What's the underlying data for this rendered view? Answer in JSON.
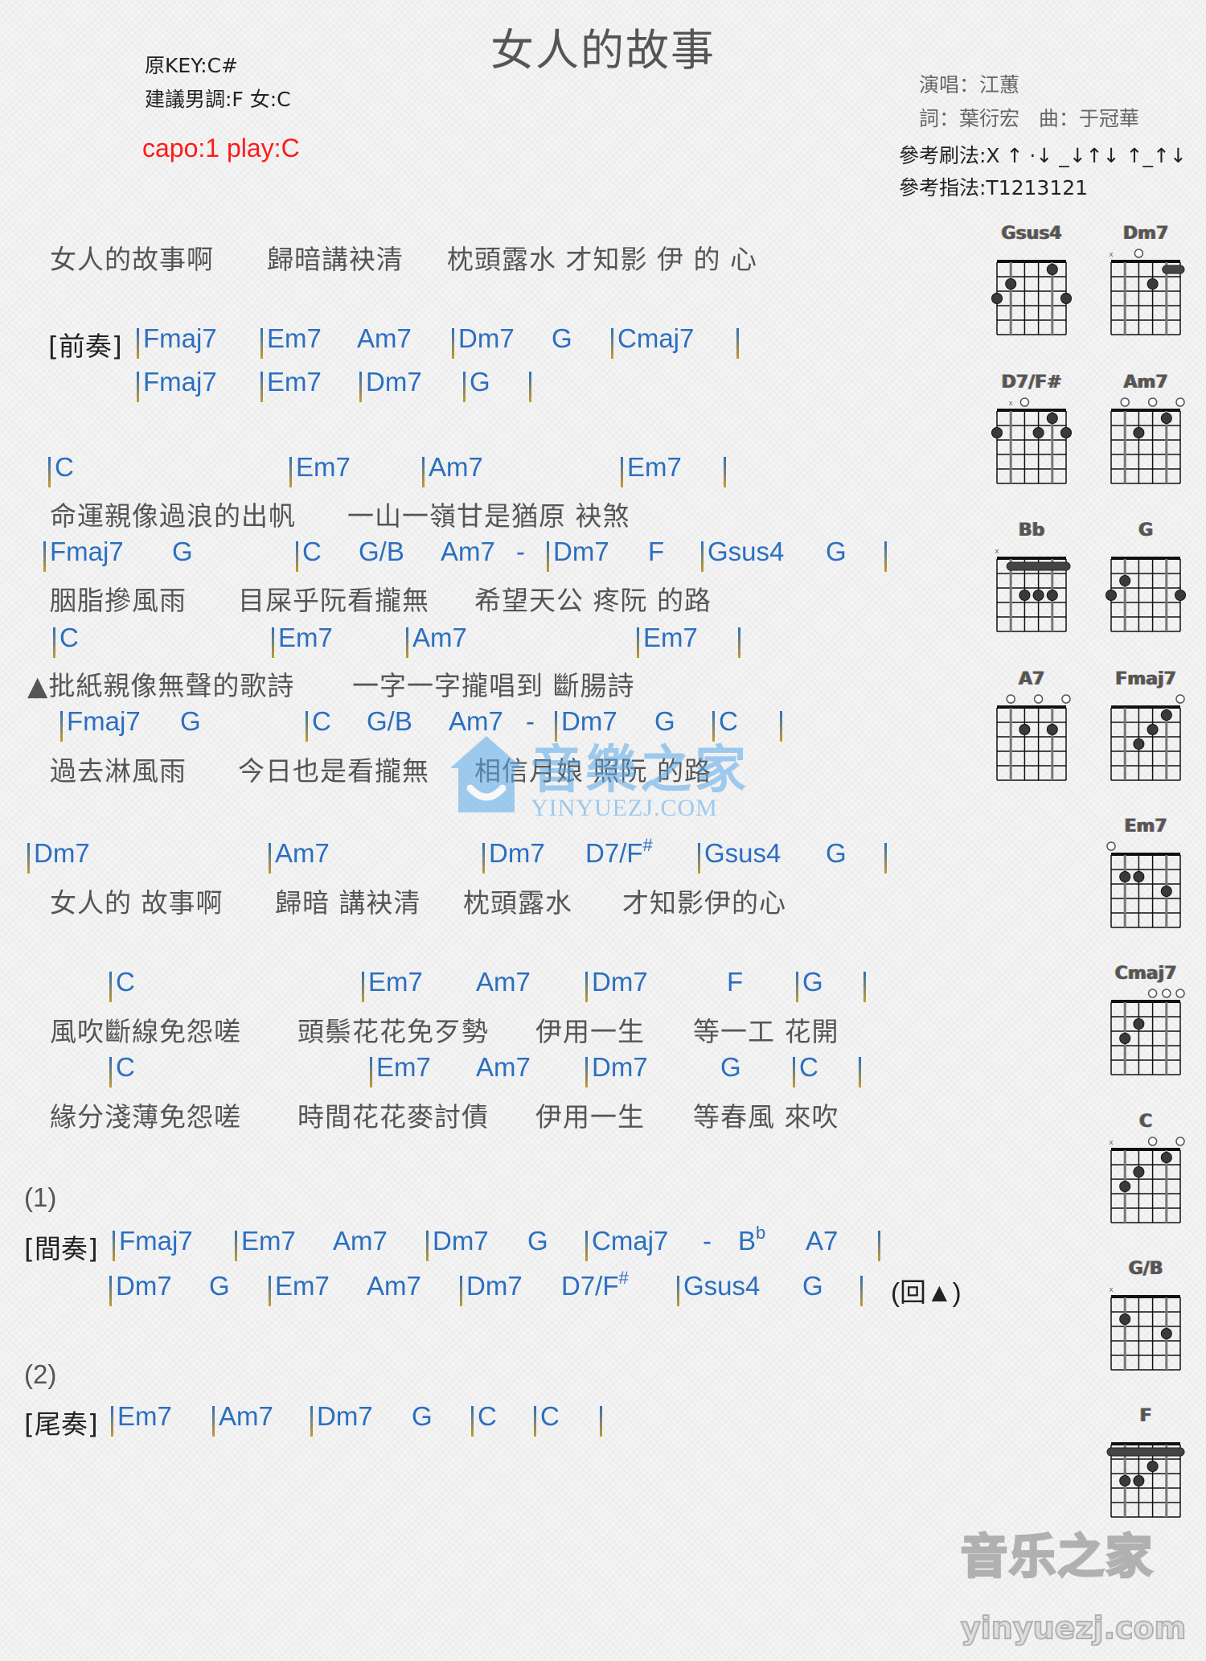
{
  "header": {
    "title": "女人的故事",
    "original_key": "原KEY:C#",
    "suggested_key": "建議男調:F 女:C",
    "capo": "capo:1 play:C",
    "singer": "演唱：江蕙",
    "writers": "詞：葉衍宏   曲：于冠華",
    "strum": "參考刷法:X ↑ ·↓ _↓↑↓ ↑_↑↓",
    "fingering": "參考指法:T1213121"
  },
  "intro_lyric": [
    "女人的故事啊",
    "歸暗講袂清",
    "枕頭露水 才知影 伊 的 心"
  ],
  "prelude": {
    "label": "[前奏]",
    "line1": [
      "Fmaj7",
      "Em7",
      "Am7",
      "Dm7",
      "G",
      "Cmaj7"
    ],
    "line2": [
      "Fmaj7",
      "Em7",
      "Dm7",
      "G"
    ]
  },
  "verse": {
    "l1_chords": [
      "C",
      "Em7",
      "Am7",
      "Em7"
    ],
    "l1_lyric": [
      "命運親像過浪的出帆",
      "一山一嶺甘是猶原 袂煞"
    ],
    "l2_chords": [
      "Fmaj7",
      "G",
      "C",
      "G/B",
      "Am7",
      "-",
      "Dm7",
      "F",
      "Gsus4",
      "G"
    ],
    "l2_lyric": [
      "胭脂摻風雨",
      "目屎乎阮看攏無",
      "希望天公 疼阮 的路"
    ],
    "l3_chords": [
      "C",
      "Em7",
      "Am7",
      "Em7"
    ],
    "l3_lyric": [
      "▲批紙親像無聲的歌詩",
      "一字一字攏唱到 斷腸詩"
    ],
    "l4_chords": [
      "Fmaj7",
      "G",
      "C",
      "G/B",
      "Am7",
      "-",
      "Dm7",
      "G",
      "C"
    ],
    "l4_lyric": [
      "過去淋風雨",
      "今日也是看攏無",
      "相信月娘 照阮 的路"
    ]
  },
  "chorus": {
    "l1_chords": [
      "Dm7",
      "Am7",
      "Dm7",
      "D7/F",
      "#",
      "Gsus4",
      "G"
    ],
    "l1_lyric": [
      "女人的 故事啊",
      "歸暗 講袂清",
      "枕頭露水",
      "才知影伊的心"
    ]
  },
  "bridge": {
    "l1_chords": [
      "C",
      "Em7",
      "Am7",
      "Dm7",
      "F",
      "G"
    ],
    "l1_lyric": [
      "風吹斷線免怨嗟",
      "頭鬃花花免歹勢",
      "伊用一生",
      "等一工 花開"
    ],
    "l2_chords": [
      "C",
      "Em7",
      "Am7",
      "Dm7",
      "G",
      "C"
    ],
    "l2_lyric": [
      "緣分淺薄免怨嗟",
      "時間花花麥討債",
      "伊用一生",
      "等春風 來吹"
    ]
  },
  "interlude": {
    "marker": "(1)",
    "label": "[間奏]",
    "line1": [
      "Fmaj7",
      "Em7",
      "Am7",
      "Dm7",
      "G",
      "Cmaj7",
      "-",
      "B",
      "b",
      "A7"
    ],
    "line2": [
      "Dm7",
      "G",
      "Em7",
      "Am7",
      "Dm7",
      "D7/F",
      "#",
      "Gsus4",
      "G"
    ],
    "repeat": "(回▲)"
  },
  "outro": {
    "marker": "(2)",
    "label": "[尾奏]",
    "line1": [
      "Em7",
      "Am7",
      "Dm7",
      "G",
      "C",
      "C"
    ]
  },
  "chord_diagrams": [
    {
      "name": "Gsus4",
      "top": [
        "",
        "",
        "",
        "",
        "",
        ""
      ],
      "dots": [
        [
          6,
          3
        ],
        [
          5,
          2
        ],
        [
          2,
          1
        ],
        [
          1,
          3
        ]
      ],
      "barre": null
    },
    {
      "name": "Dm7",
      "top": [
        "x",
        "",
        "o",
        "",
        "",
        ""
      ],
      "dots": [
        [
          3,
          2
        ]
      ],
      "barre": [
        1,
        2,
        1
      ]
    },
    {
      "name": "D7/F#",
      "top": [
        "",
        "x",
        "o",
        "",
        "",
        ""
      ],
      "dots": [
        [
          6,
          2
        ],
        [
          3,
          2
        ],
        [
          2,
          1
        ],
        [
          1,
          2
        ]
      ],
      "barre": null
    },
    {
      "name": "Am7",
      "top": [
        "",
        "o",
        "",
        "o",
        "",
        "o"
      ],
      "dots": [
        [
          4,
          2
        ],
        [
          2,
          1
        ]
      ],
      "barre": null
    },
    {
      "name": "Bb",
      "top": [
        "x",
        "",
        "",
        "",
        "",
        ""
      ],
      "dots": [
        [
          4,
          3
        ],
        [
          3,
          3
        ],
        [
          2,
          3
        ]
      ],
      "barre": [
        1,
        5,
        1
      ]
    },
    {
      "name": "G",
      "top": [
        "",
        "",
        "",
        "",
        "",
        ""
      ],
      "dots": [
        [
          6,
          3
        ],
        [
          5,
          2
        ],
        [
          1,
          3
        ]
      ],
      "barre": null
    },
    {
      "name": "A7",
      "top": [
        "",
        "o",
        "",
        "o",
        "",
        "o"
      ],
      "dots": [
        [
          4,
          2
        ],
        [
          2,
          2
        ]
      ],
      "barre": null
    },
    {
      "name": "Fmaj7",
      "top": [
        "",
        "",
        "",
        "",
        "",
        "o"
      ],
      "dots": [
        [
          4,
          3
        ],
        [
          3,
          2
        ],
        [
          2,
          1
        ]
      ],
      "barre": null
    },
    {
      "name": "Em7",
      "top": [
        "o",
        "",
        "",
        "",
        "",
        ""
      ],
      "dots": [
        [
          5,
          2
        ],
        [
          4,
          2
        ],
        [
          2,
          3
        ]
      ],
      "barre": null
    },
    {
      "name": "Cmaj7",
      "top": [
        "",
        "",
        "",
        "o",
        "o",
        "o"
      ],
      "dots": [
        [
          5,
          3
        ],
        [
          4,
          2
        ]
      ],
      "barre": null
    },
    {
      "name": "C",
      "top": [
        "x",
        "",
        "",
        "o",
        "",
        "o"
      ],
      "dots": [
        [
          5,
          3
        ],
        [
          4,
          2
        ],
        [
          2,
          1
        ]
      ],
      "barre": null
    },
    {
      "name": "G/B",
      "top": [
        "x",
        "",
        "",
        "",
        "",
        ""
      ],
      "dots": [
        [
          5,
          2
        ],
        [
          2,
          3
        ]
      ],
      "barre": null
    },
    {
      "name": "F",
      "top": [
        "",
        "",
        "",
        "",
        "",
        ""
      ],
      "dots": [
        [
          5,
          3
        ],
        [
          4,
          3
        ],
        [
          3,
          2
        ]
      ],
      "barre": [
        1,
        6,
        1
      ]
    }
  ],
  "watermarks": {
    "center_cn": "音樂之家",
    "center_en": "YINYUEZJ.COM",
    "corner_cn": "音乐之家",
    "corner_en": "yinyuezj.com"
  }
}
